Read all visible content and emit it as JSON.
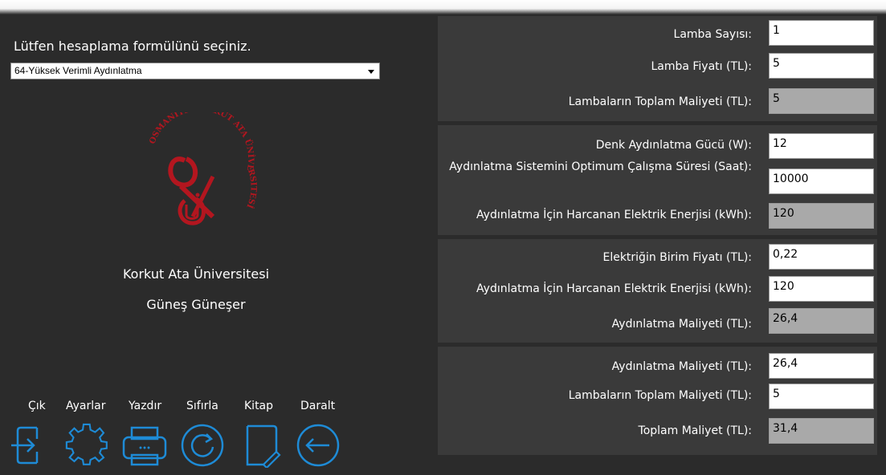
{
  "left": {
    "prompt": "Lütfen hesaplama formülünü seçiniz.",
    "formula_select": {
      "selected": "64-Yüksek Verimli Aydınlatma"
    },
    "university_name": "Korkut Ata Üniversitesi",
    "author_name": "Güneş Güneşer",
    "toolbar": [
      {
        "label": "Çık",
        "icon": "exit-icon"
      },
      {
        "label": "Ayarlar",
        "icon": "gear-icon"
      },
      {
        "label": "Yazdır",
        "icon": "printer-icon"
      },
      {
        "label": "Sıfırla",
        "icon": "reset-icon"
      },
      {
        "label": "Kitap",
        "icon": "book-icon"
      },
      {
        "label": "Daralt",
        "icon": "back-arrow-icon"
      }
    ],
    "logo": {
      "text": "OSMANİYE KORKUT ATA ÜNİVERSİTESİ",
      "color": "#b3161f"
    }
  },
  "right": {
    "group1": {
      "lamp_count_label": "Lamba Sayısı:",
      "lamp_count_value": "1",
      "lamp_price_label": "Lamba Fiyatı (TL):",
      "lamp_price_value": "5",
      "lamps_total_cost_label": "Lambaların Toplam Maliyeti (TL):",
      "lamps_total_cost_value": "5"
    },
    "group2": {
      "equiv_power_label": "Denk Aydınlatma Gücü (W):",
      "equiv_power_value": "12",
      "optimum_hours_label": "Aydınlatma Sistemini Optimum Çalışma Süresi (Saat):",
      "optimum_hours_value": "10000",
      "energy_label": "Aydınlatma İçin Harcanan Elektrik Enerjisi (kWh):",
      "energy_value": "120"
    },
    "group3": {
      "unit_price_label": "Elektriğin Birim Fiyatı (TL):",
      "unit_price_value": "0,22",
      "energy_label": "Aydınlatma İçin Harcanan Elektrik Enerjisi (kWh):",
      "energy_value": "120",
      "lighting_cost_label": "Aydınlatma Maliyeti (TL):",
      "lighting_cost_value": "26,4"
    },
    "group4": {
      "lighting_cost_label": "Aydınlatma Maliyeti (TL):",
      "lighting_cost_value": "26,4",
      "lamps_total_cost_label": "Lambaların Toplam Maliyeti (TL):",
      "lamps_total_cost_value": "5",
      "total_cost_label": "Toplam Maliyet (TL):",
      "total_cost_value": "31,4"
    }
  },
  "colors": {
    "background": "#2b2b2b",
    "panel": "#3a3a3a",
    "icon_accent": "#1e8bd6",
    "readonly_field": "#a9a9a9"
  }
}
